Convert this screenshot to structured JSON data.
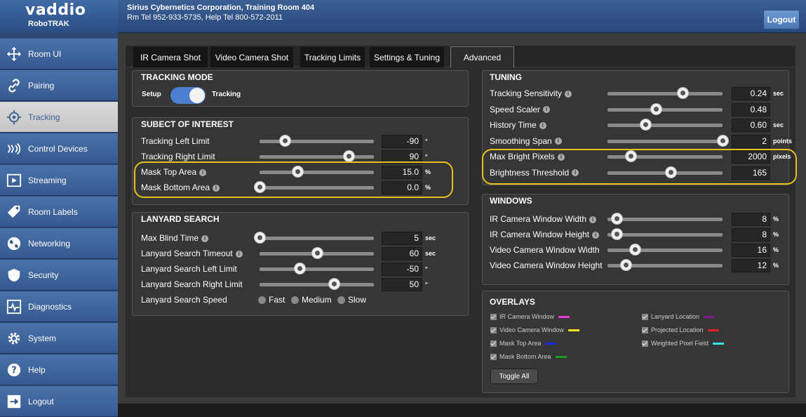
{
  "header": {
    "logo_word": "vaddio",
    "logo_sub": "RoboTRAK",
    "org": "Sirius Cybernetics Corporation, Training Room 404",
    "contact": "Rm Tel 952-933-5735, Help Tel 800-572-2011",
    "logout": "Logout"
  },
  "sidebar": {
    "items": [
      {
        "label": "Room UI",
        "icon": "move-arrows-icon"
      },
      {
        "label": "Pairing",
        "icon": "link-icon"
      },
      {
        "label": "Tracking",
        "icon": "target-icon",
        "active": true
      },
      {
        "label": "Control Devices",
        "icon": "signal-icon"
      },
      {
        "label": "Streaming",
        "icon": "play-icon"
      },
      {
        "label": "Room Labels",
        "icon": "tag-icon"
      },
      {
        "label": "Networking",
        "icon": "globe-icon"
      },
      {
        "label": "Security",
        "icon": "shield-icon"
      },
      {
        "label": "Diagnostics",
        "icon": "pulse-icon"
      },
      {
        "label": "System",
        "icon": "gear-icon"
      },
      {
        "label": "Help",
        "icon": "question-icon"
      },
      {
        "label": "Logout",
        "icon": "exit-icon"
      }
    ]
  },
  "tabs": [
    {
      "label": "IR Camera Shot"
    },
    {
      "label": "Video Camera Shot"
    },
    {
      "label": "Tracking Limits"
    },
    {
      "label": "Settings & Tuning"
    },
    {
      "label": "Advanced",
      "active": true
    }
  ],
  "tracking_mode": {
    "title": "TRACKING MODE",
    "left": "Setup",
    "right": "Tracking",
    "state": "Tracking"
  },
  "soi": {
    "title": "SUBECT OF INTEREST",
    "rows": [
      {
        "label": "Tracking Left Limit",
        "info": false,
        "value": "-90",
        "unit": "°",
        "fraction": 0.22
      },
      {
        "label": "Tracking Right Limit",
        "info": false,
        "value": "90",
        "unit": "°",
        "fraction": 0.78
      },
      {
        "label": "Mask Top Area",
        "info": true,
        "value": "15.0",
        "unit": "%",
        "fraction": 0.33
      },
      {
        "label": "Mask Bottom Area",
        "info": true,
        "value": "0.0",
        "unit": "%",
        "fraction": 0.0
      }
    ]
  },
  "lanyard": {
    "title": "LANYARD SEARCH",
    "rows": [
      {
        "label": "Max Blind Time",
        "info": true,
        "value": "5",
        "unit": "sec",
        "fraction": 0.0
      },
      {
        "label": "Lanyard Search Timeout",
        "info": true,
        "value": "60",
        "unit": "sec",
        "fraction": 0.5
      },
      {
        "label": "Lanyard Search Left Limit",
        "info": false,
        "value": "-50",
        "unit": "°",
        "fraction": 0.35
      },
      {
        "label": "Lanyard Search Right Limit",
        "info": false,
        "value": "50",
        "unit": "°",
        "fraction": 0.65
      }
    ],
    "speed_label": "Lanyard Search Speed",
    "speeds": [
      "Fast",
      "Medium",
      "Slow"
    ]
  },
  "tuning": {
    "title": "TUNING",
    "rows": [
      {
        "label": "Tracking Sensitivity",
        "info": true,
        "value": "0.24",
        "unit": "sec",
        "fraction": 0.65
      },
      {
        "label": "Speed Scaler",
        "info": true,
        "value": "0.48",
        "unit": "",
        "fraction": 0.42
      },
      {
        "label": "History Time",
        "info": true,
        "value": "0.60",
        "unit": "sec",
        "fraction": 0.33
      },
      {
        "label": "Smoothing Span",
        "info": true,
        "value": "2",
        "unit": "points",
        "fraction": 1.0
      },
      {
        "label": "Max Bright Pixels",
        "info": true,
        "value": "2000",
        "unit": "pixels",
        "fraction": 0.2
      },
      {
        "label": "Brightness Threshold",
        "info": true,
        "value": "165",
        "unit": "",
        "fraction": 0.55
      }
    ]
  },
  "windows": {
    "title": "WINDOWS",
    "rows": [
      {
        "label": "IR Camera Window Width",
        "info": true,
        "value": "8",
        "unit": "%",
        "fraction": 0.08
      },
      {
        "label": "IR Camera Window Height",
        "info": true,
        "value": "8",
        "unit": "%",
        "fraction": 0.08
      },
      {
        "label": "Video Camera Window Width",
        "info": false,
        "value": "16",
        "unit": "%",
        "fraction": 0.24
      },
      {
        "label": "Video Camera Window Height",
        "info": false,
        "value": "12",
        "unit": "%",
        "fraction": 0.16
      }
    ]
  },
  "overlays": {
    "title": "OVERLAYS",
    "left": [
      {
        "label": "IR Camera Window",
        "color": "#e53ae0"
      },
      {
        "label": "Video Camera Window",
        "color": "#f3e21c"
      },
      {
        "label": "Mask Top Area",
        "color": "#1d2ad8"
      },
      {
        "label": "Mask Bottom Area",
        "color": "#1b9a2a"
      }
    ],
    "right": [
      {
        "label": "Lanyard Location",
        "color": "#7a1d88"
      },
      {
        "label": "Projected Location",
        "color": "#e02020"
      },
      {
        "label": "Weighted Pixel Field",
        "color": "#2ee6e6"
      }
    ],
    "toggle_all": "Toggle All"
  },
  "colors": {
    "highlight": "#e6c21c",
    "accent": "#4d7fd0",
    "topbar": "#3b5f94"
  }
}
